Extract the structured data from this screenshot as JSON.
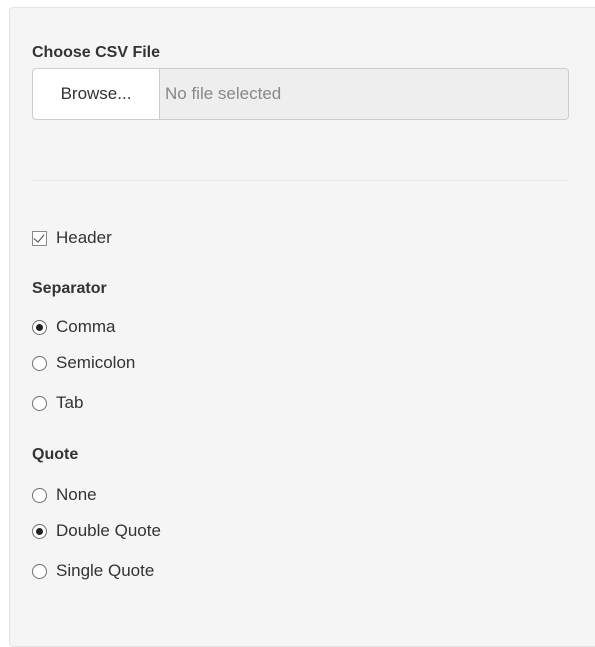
{
  "file_input": {
    "label": "Choose CSV File",
    "browse_label": "Browse...",
    "status_text": "No file selected"
  },
  "header_checkbox": {
    "label": "Header",
    "checked": true
  },
  "separator": {
    "label": "Separator",
    "options": [
      {
        "label": "Comma",
        "selected": true
      },
      {
        "label": "Semicolon",
        "selected": false
      },
      {
        "label": "Tab",
        "selected": false
      }
    ]
  },
  "quote": {
    "label": "Quote",
    "options": [
      {
        "label": "None",
        "selected": false
      },
      {
        "label": "Double Quote",
        "selected": true
      },
      {
        "label": "Single Quote",
        "selected": false
      }
    ]
  },
  "colors": {
    "panel_background": "#f5f5f5",
    "file_display_background": "#eeeeee"
  },
  "icons": {
    "checkbox": "checkbox-checked-icon",
    "radio_selected": "radio-selected-icon",
    "radio_unselected": "radio-unselected-icon"
  }
}
